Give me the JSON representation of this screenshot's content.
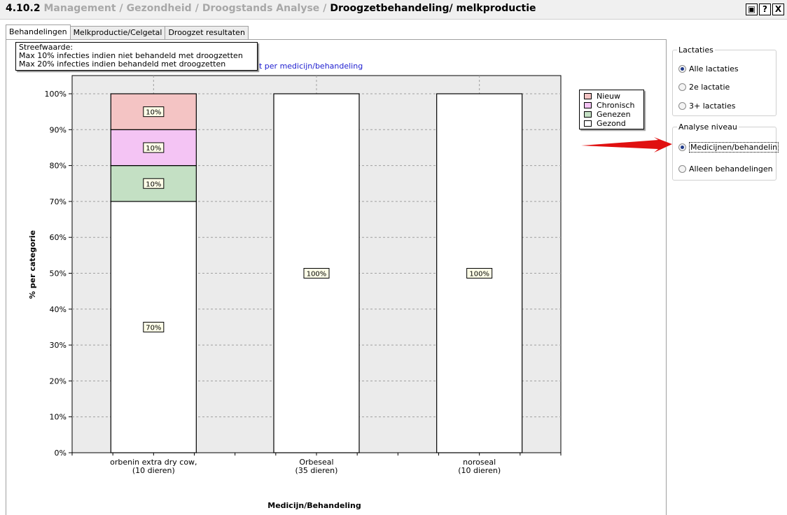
{
  "title": {
    "number": "4.10.2",
    "crumbs": [
      "Management",
      "Gezondheid",
      "Droogstands Analyse"
    ],
    "current": "Droogzetbehandeling/ melkproductie"
  },
  "window_buttons": {
    "restore": "▣",
    "help": "?",
    "close": "X"
  },
  "tabs": [
    {
      "label": "Behandelingen",
      "active": true
    },
    {
      "label": "Melkproductie/Celgetal",
      "active": false
    },
    {
      "label": "Droogzet resultaten",
      "active": false
    }
  ],
  "tooltip": {
    "line1": "Streefwaarde:",
    "line2": "Max 10% infecties indien niet behandeld met droogzetten",
    "line3": "Max 20% infecties indien behandeld met droogzetten"
  },
  "chart_title_visible": "t per medicijn/behandeling",
  "chart_data": {
    "type": "bar",
    "stacked": true,
    "categories": [
      [
        "orbenin extra dry cow,",
        "(10 dieren)"
      ],
      [
        "Orbeseal",
        "(35 dieren)"
      ],
      [
        "noroseal",
        "(10 dieren)"
      ]
    ],
    "series": [
      {
        "name": "Gezond",
        "color": "#ffffff",
        "values": [
          70,
          100,
          100
        ]
      },
      {
        "name": "Genezen",
        "color": "#c4e0c4",
        "values": [
          10,
          0,
          0
        ]
      },
      {
        "name": "Chronisch",
        "color": "#f4c4f4",
        "values": [
          10,
          0,
          0
        ]
      },
      {
        "name": "Nieuw",
        "color": "#f4c4c4",
        "values": [
          10,
          0,
          0
        ]
      }
    ],
    "legend_order": [
      "Nieuw",
      "Chronisch",
      "Genezen",
      "Gezond"
    ],
    "ylabel": "% per categorie",
    "xlabel": "Medicijn/Behandeling",
    "ylim": [
      0,
      100
    ],
    "yticks": [
      "0%",
      "10%",
      "20%",
      "30%",
      "40%",
      "50%",
      "60%",
      "70%",
      "80%",
      "90%",
      "100%"
    ],
    "grid": true,
    "legend_position": "top-right"
  },
  "right_panel": {
    "lactaties": {
      "legend": "Lactaties",
      "options": [
        {
          "label": "Alle lactaties",
          "selected": true
        },
        {
          "label": "2e lactatie",
          "selected": false
        },
        {
          "label": "3+ lactaties",
          "selected": false
        }
      ]
    },
    "analyse": {
      "legend": "Analyse niveau",
      "options": [
        {
          "label": "Medicijnen/behandelin",
          "selected": true
        },
        {
          "label": "Alleen behandelingen",
          "selected": false
        }
      ]
    }
  },
  "colors": {
    "accent_arrow": "#e01010",
    "plot_bg": "#ebebeb"
  }
}
